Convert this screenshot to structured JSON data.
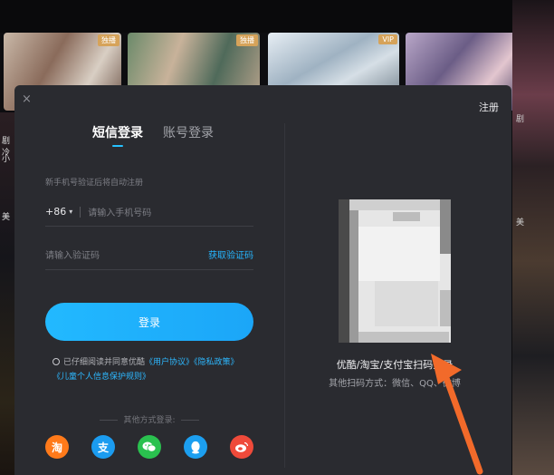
{
  "posters": [
    {
      "badge": "独播"
    },
    {
      "badge": "独播"
    },
    {
      "badge": "VIP"
    },
    {
      "badge": ""
    }
  ],
  "side_left": {
    "texts": [
      "剧冷",
      "小",
      "美"
    ]
  },
  "side_right": {
    "texts": [
      "剧",
      "美"
    ]
  },
  "modal": {
    "close": "×",
    "register": "注册",
    "tabs": [
      {
        "label": "短信登录",
        "active": true
      },
      {
        "label": "账号登录",
        "active": false
      }
    ],
    "hint": "新手机号验证后将自动注册",
    "country_code": "+86",
    "phone_placeholder": "请输入手机号码",
    "code_placeholder": "请输入验证码",
    "get_code": "获取验证码",
    "login_button": "登录",
    "agreement": {
      "prefix": "已仔细阅读并同意优酷",
      "user_agreement": "《用户协议》",
      "privacy": "《隐私政策》",
      "child_policy": "《儿童个人信息保护规则》"
    },
    "other_methods": "其他方式登录:",
    "socials": [
      {
        "icon": "taobao-icon",
        "glyph": "淘"
      },
      {
        "icon": "alipay-icon",
        "glyph": "支"
      },
      {
        "icon": "wechat-icon",
        "glyph": "◉"
      },
      {
        "icon": "qq-icon",
        "glyph": "●"
      },
      {
        "icon": "weibo-icon",
        "glyph": "◎"
      }
    ],
    "qr_title": "优酷/淘宝/支付宝扫码登录",
    "qr_sub": "其他扫码方式：微信、QQ、微博"
  },
  "colors": {
    "accent": "#26b6ff",
    "modal_bg": "#2a2b30",
    "annotation_arrow": "#f26a2a"
  }
}
